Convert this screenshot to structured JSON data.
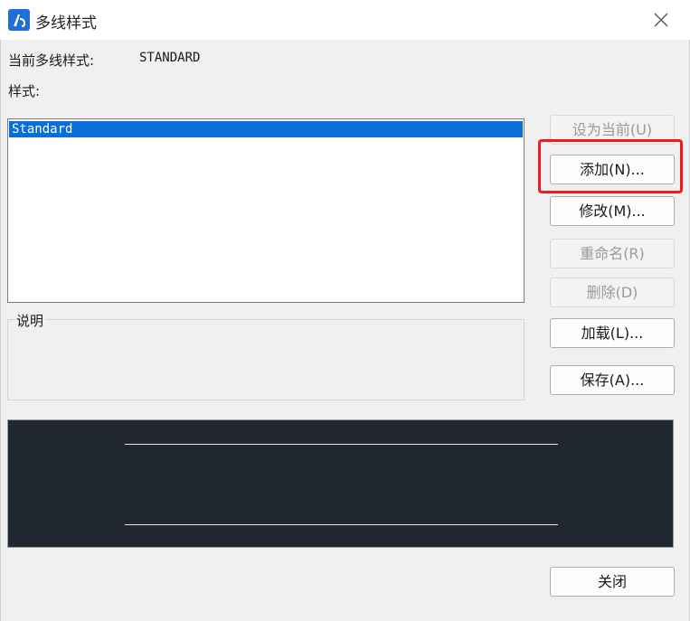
{
  "window": {
    "title": "多线样式",
    "icon": "autocad-app-icon",
    "close_icon": "close-icon"
  },
  "current_style": {
    "label": "当前多线样式:",
    "value": "STANDARD"
  },
  "styles": {
    "label": "样式:",
    "items": [
      {
        "name": "Standard",
        "selected": true
      }
    ]
  },
  "description": {
    "label": "说明",
    "text": ""
  },
  "buttons": {
    "set_current": {
      "label": "设为当前(U)",
      "enabled": false
    },
    "add": {
      "label": "添加(N)...",
      "enabled": true,
      "highlighted": true
    },
    "modify": {
      "label": "修改(M)...",
      "enabled": true
    },
    "rename": {
      "label": "重命名(R)",
      "enabled": false
    },
    "delete": {
      "label": "删除(D)",
      "enabled": false
    },
    "load": {
      "label": "加载(L)...",
      "enabled": true
    },
    "save": {
      "label": "保存(A)...",
      "enabled": true
    },
    "close": {
      "label": "关闭",
      "enabled": true
    }
  },
  "colors": {
    "selection": "#0a6ed8",
    "preview_background": "#202730",
    "highlight": "#ee1c1c"
  }
}
